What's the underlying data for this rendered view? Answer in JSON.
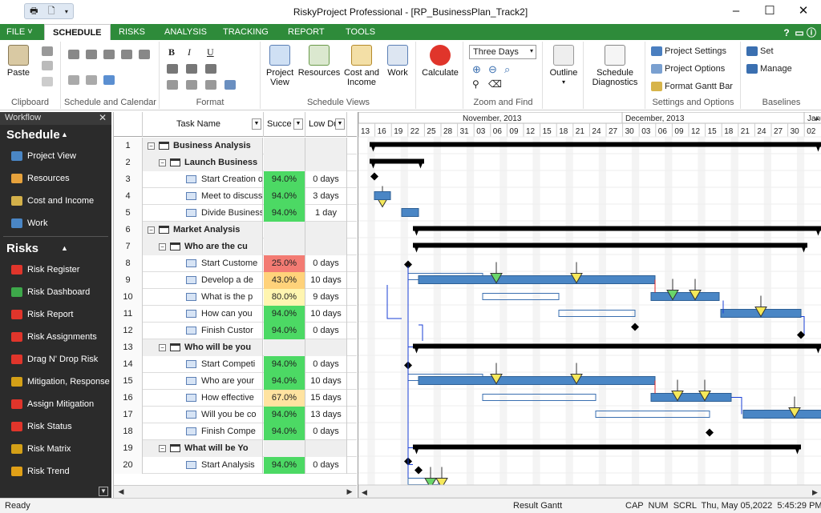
{
  "window": {
    "title": "RiskyProject Professional - [RP_BusinessPlan_Track2]",
    "qat_icons": [
      "print-icon",
      "print-preview-icon"
    ],
    "controls": [
      "–",
      "☐",
      "✕"
    ]
  },
  "ribbon": {
    "tabs": [
      "FILE",
      "SCHEDULE",
      "RISKS",
      "ANALYSIS",
      "TRACKING",
      "REPORT",
      "TOOLS"
    ],
    "active_tab": "SCHEDULE",
    "right_icons": "?",
    "groups": {
      "clipboard": {
        "label": "Clipboard",
        "paste": "Paste"
      },
      "schedule_calendar": {
        "label": "Schedule and Calendar"
      },
      "format": {
        "label": "Format",
        "bold": "B",
        "italic": "I",
        "underline": "U"
      },
      "schedule_views": {
        "label": "Schedule Views",
        "project_view": "Project View",
        "resources": "Resources",
        "cost_income": "Cost and Income",
        "work": "Work"
      },
      "calculate": {
        "label": "Calculate"
      },
      "zoom": {
        "label": "Zoom and Find",
        "zoom_value": "Three Days"
      },
      "outline": {
        "label": "Outline"
      },
      "diagnostics": {
        "label": "Schedule Diagnostics"
      },
      "settings": {
        "label": "Settings and Options",
        "project_settings": "Project Settings",
        "project_options": "Project Options",
        "format_gantt": "Format Gantt Bar"
      },
      "baselines": {
        "label": "Baselines",
        "set": "Set",
        "manage": "Manage"
      }
    }
  },
  "workflow": {
    "title": "Workflow",
    "schedule_section": "Schedule",
    "schedule_items": [
      "Project View",
      "Resources",
      "Cost and Income",
      "Work"
    ],
    "risks_section": "Risks",
    "risk_items": [
      "Risk Register",
      "Risk Dashboard",
      "Risk Report",
      "Risk Assignments",
      "Drag N' Drop Risk",
      "Mitigation, Response",
      "Assign Mitigation",
      "Risk Status",
      "Risk Matrix",
      "Risk Trend"
    ]
  },
  "grid": {
    "columns": [
      "Task Name",
      "Succe",
      "Low Du"
    ],
    "rows": [
      {
        "num": "1",
        "name": "Business Analysis",
        "level": 0,
        "summary": true,
        "succ": "",
        "low": "",
        "succ_color": ""
      },
      {
        "num": "2",
        "name": "Launch Business",
        "level": 1,
        "summary": true,
        "succ": "",
        "low": "",
        "succ_color": ""
      },
      {
        "num": "3",
        "name": "Start Creation of",
        "level": 2,
        "summary": false,
        "succ": "94.0%",
        "low": "0 days",
        "succ_color": "#4cd964"
      },
      {
        "num": "4",
        "name": "Meet to discuss i",
        "level": 2,
        "summary": false,
        "succ": "94.0%",
        "low": "3 days",
        "succ_color": "#4cd964"
      },
      {
        "num": "5",
        "name": "Divide Business",
        "level": 2,
        "summary": false,
        "succ": "94.0%",
        "low": "1 day",
        "succ_color": "#4cd964"
      },
      {
        "num": "6",
        "name": "Market Analysis",
        "level": 0,
        "summary": true,
        "succ": "",
        "low": "",
        "succ_color": ""
      },
      {
        "num": "7",
        "name": "Who are the cu",
        "level": 1,
        "summary": true,
        "succ": "",
        "low": "",
        "succ_color": ""
      },
      {
        "num": "8",
        "name": "Start Custome",
        "level": 2,
        "summary": false,
        "succ": "25.0%",
        "low": "0 days",
        "succ_color": "#f37b73"
      },
      {
        "num": "9",
        "name": "Develop a de",
        "level": 2,
        "summary": false,
        "succ": "43.0%",
        "low": "10 days",
        "succ_color": "#ffd27a"
      },
      {
        "num": "10",
        "name": "What is the p",
        "level": 2,
        "summary": false,
        "succ": "80.0%",
        "low": "9 days",
        "succ_color": "#fff5b0"
      },
      {
        "num": "11",
        "name": "How can you",
        "level": 2,
        "summary": false,
        "succ": "94.0%",
        "low": "10 days",
        "succ_color": "#4cd964"
      },
      {
        "num": "12",
        "name": "Finish Custor",
        "level": 2,
        "summary": false,
        "succ": "94.0%",
        "low": "0 days",
        "succ_color": "#4cd964"
      },
      {
        "num": "13",
        "name": "Who will be you",
        "level": 1,
        "summary": true,
        "succ": "",
        "low": "",
        "succ_color": ""
      },
      {
        "num": "14",
        "name": "Start Competi",
        "level": 2,
        "summary": false,
        "succ": "94.0%",
        "low": "0 days",
        "succ_color": "#4cd964"
      },
      {
        "num": "15",
        "name": "Who are your",
        "level": 2,
        "summary": false,
        "succ": "94.0%",
        "low": "10 days",
        "succ_color": "#4cd964"
      },
      {
        "num": "16",
        "name": "How effective",
        "level": 2,
        "summary": false,
        "succ": "67.0%",
        "low": "15 days",
        "succ_color": "#ffe3a0"
      },
      {
        "num": "17",
        "name": "Will you be co",
        "level": 2,
        "summary": false,
        "succ": "94.0%",
        "low": "13 days",
        "succ_color": "#4cd964"
      },
      {
        "num": "18",
        "name": "Finish Compe",
        "level": 2,
        "summary": false,
        "succ": "94.0%",
        "low": "0 days",
        "succ_color": "#4cd964"
      },
      {
        "num": "19",
        "name": "What will be Yo",
        "level": 1,
        "summary": true,
        "succ": "",
        "low": "",
        "succ_color": ""
      },
      {
        "num": "20",
        "name": "Start Analysis",
        "level": 2,
        "summary": false,
        "succ": "94.0%",
        "low": "0 days",
        "succ_color": "#4cd964"
      }
    ]
  },
  "gantt": {
    "months": [
      "November, 2013",
      "December, 2013",
      "Janu"
    ],
    "days": [
      "13",
      "16",
      "19",
      "22",
      "25",
      "28",
      "31",
      "03",
      "06",
      "09",
      "12",
      "15",
      "18",
      "21",
      "24",
      "27",
      "30",
      "03",
      "06",
      "09",
      "12",
      "15",
      "18",
      "21",
      "24",
      "27",
      "30",
      "02"
    ]
  },
  "statusbar": {
    "left": "Ready",
    "center": "Result Gantt",
    "right": "CAP  NUM  SCRL  Thu, May 05,2022  5:45:29 PM"
  },
  "colors": {
    "ribbon_green": "#2e8b3a",
    "bar_blue": "#4a86c5",
    "summary_black": "#000000"
  }
}
